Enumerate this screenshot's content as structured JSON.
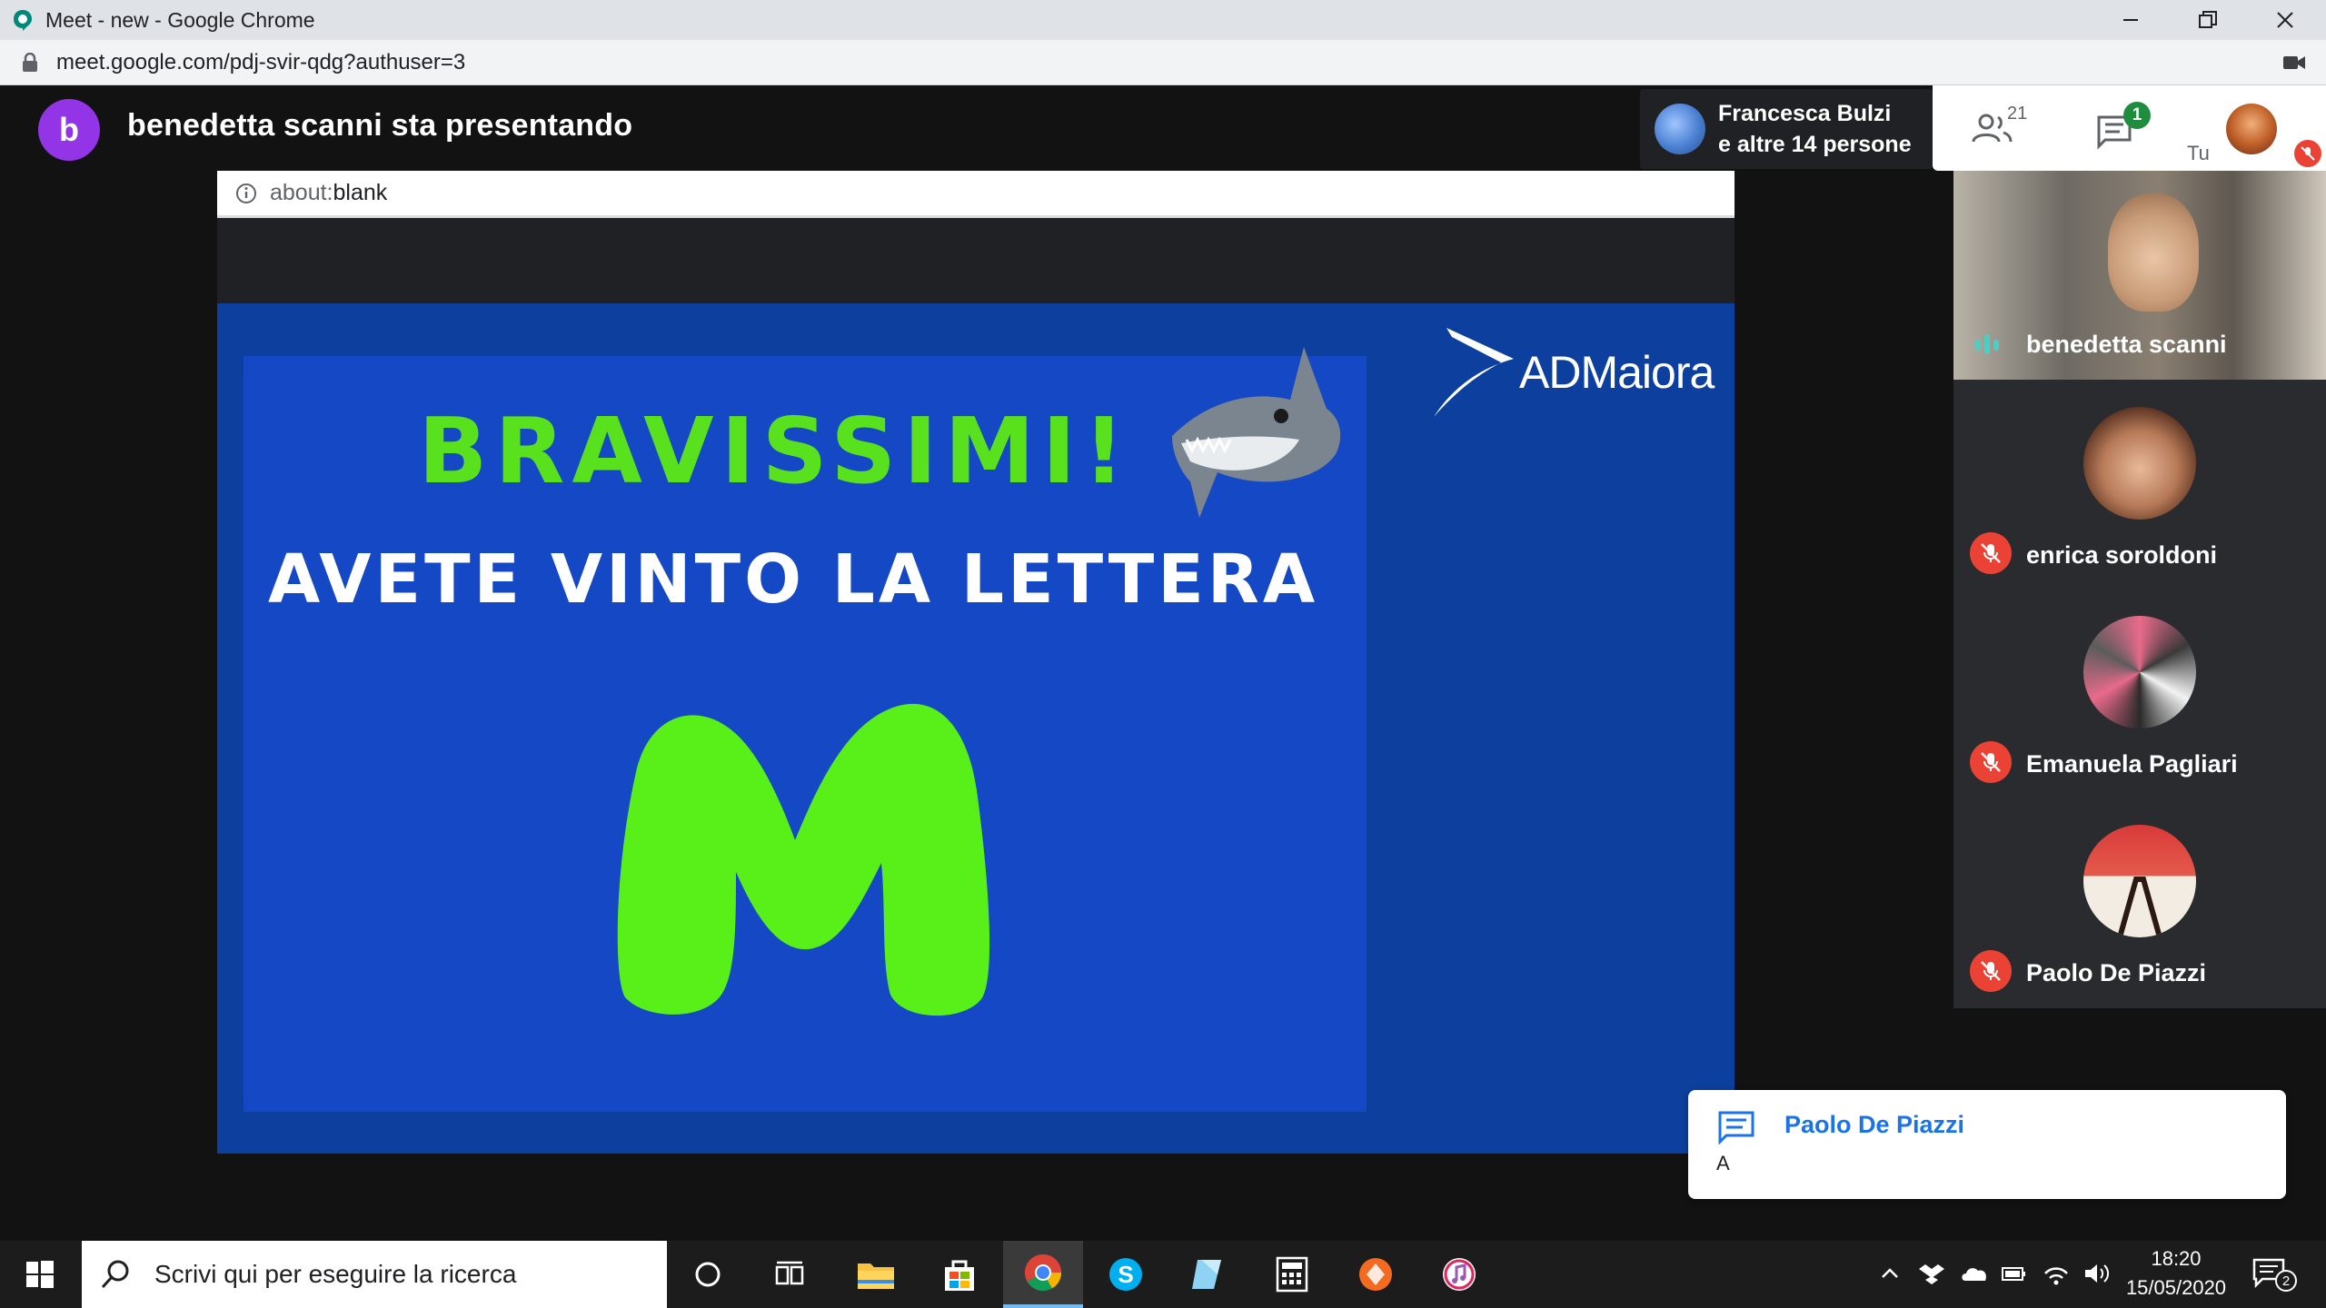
{
  "browser": {
    "window_title": "Meet - new - Google Chrome",
    "url": "meet.google.com/pdj-svir-qdg?authuser=3"
  },
  "meet": {
    "presenter_initial": "b",
    "presenting_label": "benedetta scanni sta presentando",
    "people_chip": {
      "line1": "Francesca Bulzi",
      "line2": "e altre 14 persone"
    },
    "controls": {
      "participants_count": "21",
      "chat_badge": "1",
      "self_label": "Tu"
    },
    "accent_color": "#1a73e8",
    "mute_color": "#ea4335"
  },
  "presentation": {
    "address_scheme": "about:",
    "address_path": "blank",
    "slide_title": "BRAVISSIMI!",
    "slide_subtitle": "AVETE VINTO LA LETTERA",
    "slide_letter": "M",
    "brand": "ADMaiora",
    "title_color": "#59e11e",
    "background_color": "#1448c4"
  },
  "participants": [
    {
      "name": "benedetta scanni",
      "speaking": true
    },
    {
      "name": "enrica soroldoni",
      "muted": true
    },
    {
      "name": "Emanuela Pagliari",
      "muted": true
    },
    {
      "name": "Paolo De Piazzi",
      "muted": true
    }
  ],
  "chat_toast": {
    "sender": "Paolo De Piazzi",
    "message": "A"
  },
  "taskbar": {
    "search_placeholder": "Scrivi qui per eseguire la ricerca",
    "time": "18:20",
    "date": "15/05/2020",
    "notification_count": "2",
    "apps": [
      "cortana-icon",
      "task-view-icon",
      "file-explorer-icon",
      "store-icon",
      "chrome-icon",
      "skype-icon",
      "notepad-icon",
      "calculator-icon",
      "app-orange-icon",
      "itunes-icon"
    ]
  }
}
